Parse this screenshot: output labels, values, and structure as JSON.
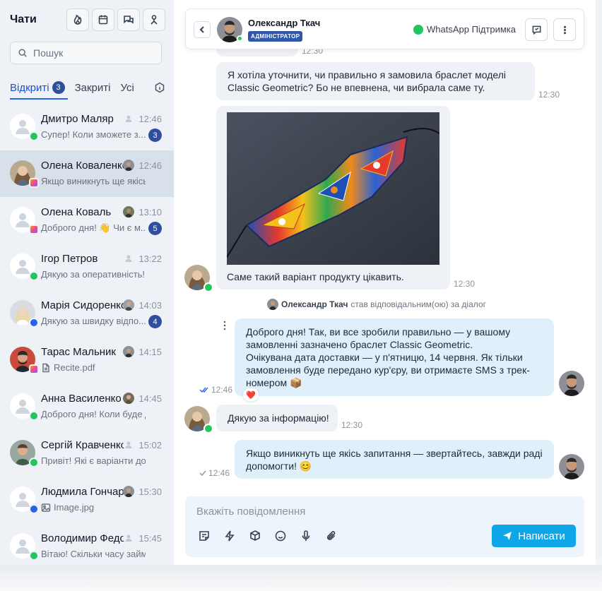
{
  "sidebar": {
    "title": "Чати",
    "search_placeholder": "Пошук",
    "tabs": [
      {
        "label": "Відкриті",
        "count": "3"
      },
      {
        "label": "Закриті"
      },
      {
        "label": "Усі"
      }
    ],
    "chats": [
      {
        "name": "Дмитро Маляр",
        "time": "12:46",
        "preview": "Супер! Коли зможете з...",
        "unread": "3",
        "channel": "whatsapp"
      },
      {
        "name": "Олена Коваленко",
        "time": "12:46",
        "preview": "Якщо виникнуть ще якісь з...",
        "unread": "",
        "channel": "instagram"
      },
      {
        "name": "Олена Коваль",
        "time": "13:10",
        "preview": "Доброго дня! 👋 Чи є м...",
        "unread": "5",
        "channel": "instagram"
      },
      {
        "name": "Ігор Петров",
        "time": "13:22",
        "preview": "Дякую за оперативність!",
        "unread": "",
        "channel": "whatsapp"
      },
      {
        "name": "Марія Сидоренко",
        "time": "14:03",
        "preview": "Дякую за швидку відпо...",
        "unread": "4",
        "channel": "messenger"
      },
      {
        "name": "Тарас Мальник",
        "time": "14:15",
        "preview": "Recite.pdf",
        "unread": "",
        "channel": "instagram"
      },
      {
        "name": "Анна Василенко",
        "time": "14:45",
        "preview": "Доброго дня! Коли буде до...",
        "unread": "",
        "channel": "whatsapp"
      },
      {
        "name": "Сергій Кравченко",
        "time": "15:02",
        "preview": "Привіт! Які є варіанти дост...",
        "unread": "",
        "channel": "whatsapp"
      },
      {
        "name": "Людмила Гончарук",
        "time": "15:30",
        "preview": "Image.jpg",
        "unread": "",
        "channel": "messenger"
      },
      {
        "name": "Володимир Федоренко",
        "time": "15:45",
        "preview": "Вітаю! Скільки часу займає...",
        "unread": "",
        "channel": "whatsapp"
      }
    ]
  },
  "header": {
    "agent_name": "Олександр Ткач",
    "agent_role": "АДМІНІСТРАТОР",
    "channel_label": "WhatsApp Підтримка"
  },
  "messages": [
    {
      "text": "",
      "time": "12:30"
    },
    {
      "text": "Я хотіла уточнити, чи правильно я замовила браслет моделі Classic Geometric? Бо не впевнена, чи вибрала саме ту.",
      "time": "12:30"
    },
    {
      "text": "Саме такий варіант продукту цікавить.",
      "time": "12:30"
    },
    {
      "text": "Доброго дня! Так, ви все зробили правильно — у вашому замовленні зазначено браслет Classic Geometric.\nОчікувана дата доставки — у п'ятницю, 14 червня. Як тільки замовлення буде передано кур'єру, ви отримаєте SMS з трек-номером 📦",
      "time": "12:46",
      "reaction": "❤️"
    },
    {
      "text": "Дякую за інформацію!",
      "time": "12:30"
    },
    {
      "text": "Якщо виникнуть ще якісь запитання — звертайтесь, завжди раді допомогти! 😊",
      "time": "12:46"
    }
  ],
  "system_event": {
    "actor": "Олександр Ткач",
    "text": "став відповідальним(ою) за діалог"
  },
  "composer": {
    "placeholder": "Вкажіть повідомлення",
    "send_label": "Написати"
  },
  "colors": {
    "accent": "#0ea5e9",
    "badge": "#2f4f9e",
    "incoming": "#eef1f5",
    "outgoing": "#dff0fb"
  }
}
